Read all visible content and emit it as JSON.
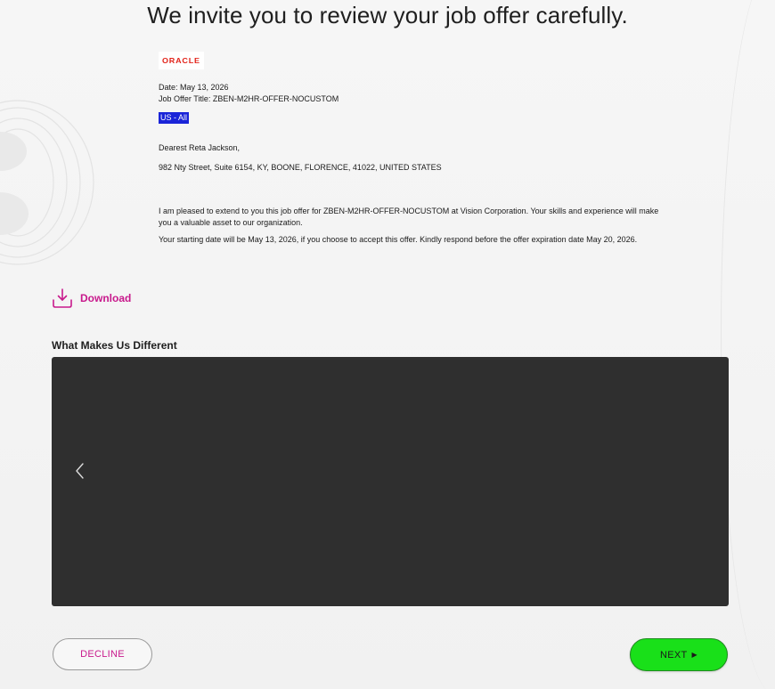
{
  "header": {
    "title": "We invite you to review your job offer carefully."
  },
  "letter": {
    "logo_text": "ORACLE",
    "date_line": "Date: May 13, 2026",
    "job_title_line": "Job Offer Title: ZBEN-M2HR-OFFER-NOCUSTOM",
    "tag": "US - All",
    "greeting": "Dearest Reta Jackson,",
    "address": "982 Nty Street, Suite 6154, KY, BOONE, FLORENCE, 41022, UNITED STATES",
    "paragraph_1": "I am pleased to extend to you this job offer for ZBEN-M2HR-OFFER-NOCUSTOM at Vision Corporation. Your skills and experience will make you a valuable asset to our organization.",
    "paragraph_2": "Your starting date will be May 13, 2026, if you choose to accept this offer. Kindly respond before the offer expiration date May 20, 2026."
  },
  "download": {
    "icon": "download-icon",
    "label": "Download"
  },
  "section": {
    "title": "What Makes Us Different"
  },
  "media": {
    "prev_icon": "chevron-left-icon"
  },
  "actions": {
    "decline_label": "DECLINE",
    "next_label": "NEXT",
    "next_icon": "caret-right-icon"
  },
  "colors": {
    "accent": "#c8198c",
    "next_button": "#19e019",
    "tag_background": "#1a24d8",
    "logo_red": "#e2231a",
    "media_background": "#2f2f2f"
  }
}
